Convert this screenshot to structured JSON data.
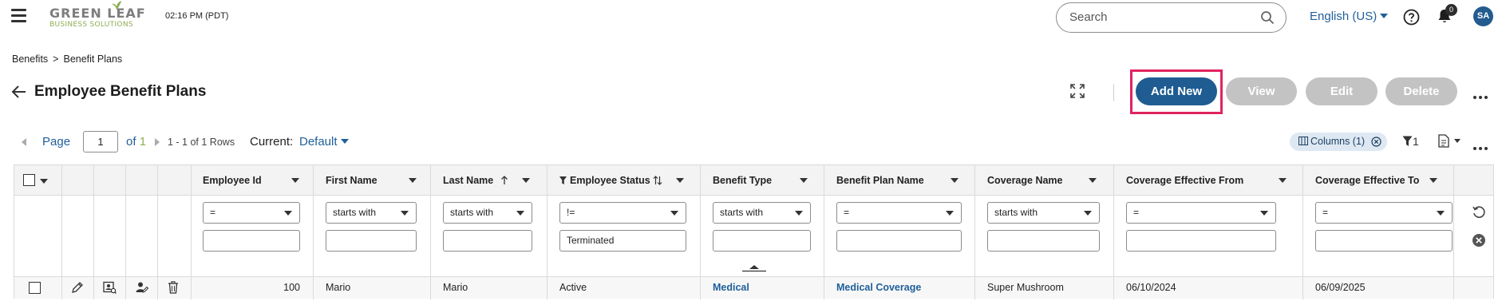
{
  "header": {
    "logo_line1": "GREEN LEAF",
    "logo_line2": "BUSINESS SOLUTIONS",
    "time": "02:16 PM (PDT)",
    "search_placeholder": "Search",
    "language": "English (US)",
    "notification_count": "0",
    "avatar_initials": "SA"
  },
  "breadcrumb": [
    "Benefits",
    ">",
    "Benefit Plans"
  ],
  "page_title": "Employee Benefit Plans",
  "toolbar": {
    "add_new": "Add New",
    "view": "View",
    "edit": "Edit",
    "delete": "Delete",
    "add_new_color": "#1e5c91",
    "disabled_color": "#c3c3c3",
    "highlight_color": "#e0245e"
  },
  "pager": {
    "page_label": "Page",
    "page_value": "1",
    "of_label": "of",
    "of_value": "1",
    "rows_text": "1 - 1 of 1 Rows",
    "current_label": "Current:",
    "current_value": "Default",
    "columns_chip": "Columns (1)",
    "filter_count": "1"
  },
  "grid": {
    "columns": [
      {
        "label": "Employee Id"
      },
      {
        "label": "First Name"
      },
      {
        "label": "Last Name"
      },
      {
        "label": "Employee Status"
      },
      {
        "label": "Benefit Type"
      },
      {
        "label": "Benefit Plan Name"
      },
      {
        "label": "Coverage Name"
      },
      {
        "label": "Coverage Effective From"
      },
      {
        "label": "Coverage Effective To"
      }
    ],
    "filters": [
      {
        "op": "=",
        "value": ""
      },
      {
        "op": "starts with",
        "value": ""
      },
      {
        "op": "starts with",
        "value": ""
      },
      {
        "op": "!=",
        "value": "Terminated"
      },
      {
        "op": "starts with",
        "value": ""
      },
      {
        "op": "=",
        "value": ""
      },
      {
        "op": "starts with",
        "value": ""
      },
      {
        "op": "=",
        "value": ""
      },
      {
        "op": "=",
        "value": ""
      }
    ],
    "rows": [
      {
        "employee_id": "100",
        "first_name": "Mario",
        "last_name": "Mario",
        "employee_status": "Active",
        "benefit_type": "Medical",
        "benefit_plan_name": "Medical Coverage",
        "coverage_name": "Super Mushroom",
        "coverage_effective_from": "06/10/2024",
        "coverage_effective_to": "06/09/2025"
      }
    ]
  }
}
